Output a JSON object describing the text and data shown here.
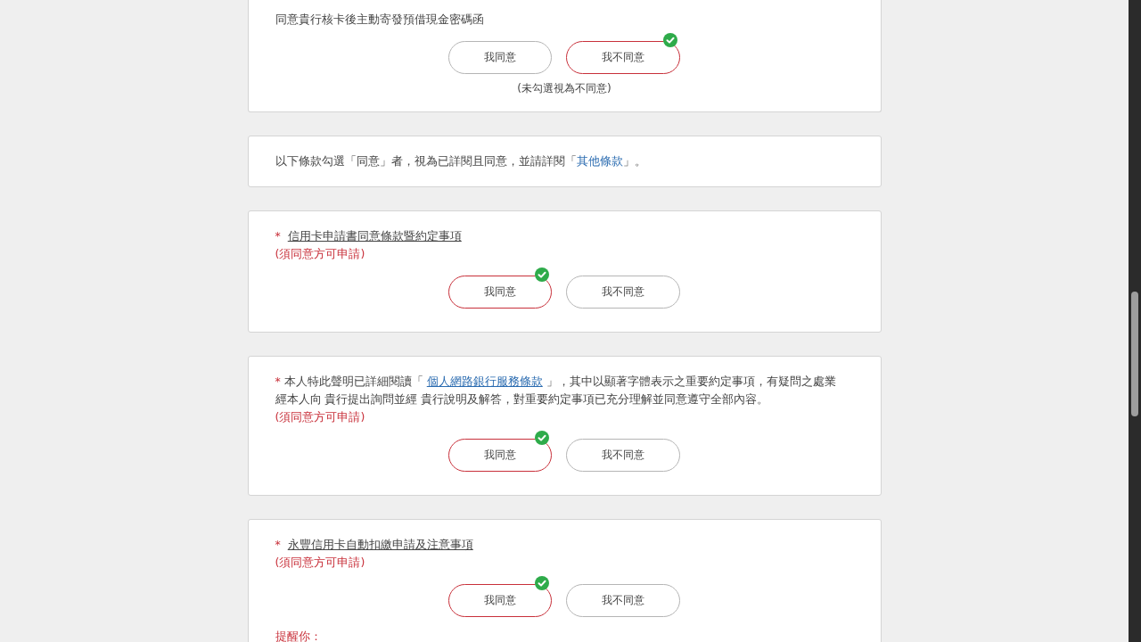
{
  "sections": [
    {
      "kind": "choice",
      "prompt": [
        {
          "kind": "plain",
          "text": "同意貴行核卡後主動寄發預借現金密碼函"
        }
      ],
      "options": [
        {
          "label": "我同意",
          "selected": false
        },
        {
          "label": "我不同意",
          "selected": true
        }
      ],
      "hint": "(未勾選視為不同意)"
    },
    {
      "kind": "notice",
      "prompt": [
        {
          "kind": "plain",
          "text": "以下條款勾選「同意」者，視為已詳閱且同意，並請詳閱「"
        },
        {
          "kind": "link",
          "text": "其他條款"
        },
        {
          "kind": "plain",
          "text": "」。"
        }
      ]
    },
    {
      "kind": "choice",
      "marker": "*",
      "prompt": [
        {
          "kind": "underlined",
          "text": "信用卡申請書同意條款暨約定事項"
        }
      ],
      "note": "(須同意方可申請)",
      "options": [
        {
          "label": "我同意",
          "selected": true
        },
        {
          "label": "我不同意",
          "selected": false
        }
      ]
    },
    {
      "kind": "choice",
      "marker": "*",
      "prompt": [
        {
          "kind": "plain",
          "text": "本人特此聲明已詳細閱讀「 "
        },
        {
          "kind": "underlined-link",
          "text": "個人網路銀行服務條款"
        },
        {
          "kind": "plain",
          "text": " 」，其中以顯著字體表示之重要約定事項，有疑問之處業經本人向 貴行提出詢問並經 貴行說明及解答，對重要約定事項已充分理解並同意遵守全部內容。"
        }
      ],
      "note": "(須同意方可申請)",
      "options": [
        {
          "label": "我同意",
          "selected": true
        },
        {
          "label": "我不同意",
          "selected": false
        }
      ]
    },
    {
      "kind": "choice",
      "marker": "*",
      "prompt": [
        {
          "kind": "underlined",
          "text": "永豐信用卡自動扣繳申請及注意事項"
        }
      ],
      "note": "(須同意方可申請)",
      "options": [
        {
          "label": "我同意",
          "selected": true
        },
        {
          "label": "我不同意",
          "selected": false
        }
      ],
      "after": "提醒你："
    }
  ]
}
